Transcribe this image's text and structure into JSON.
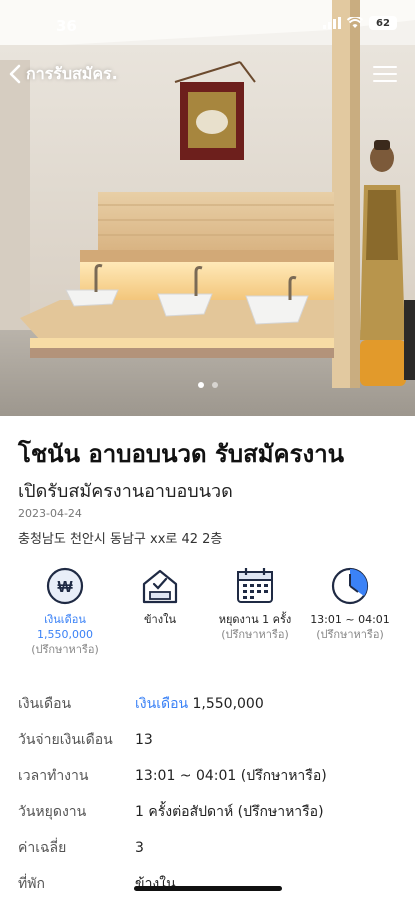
{
  "status_bar": {
    "time": "36",
    "battery": "62"
  },
  "nav": {
    "back_label": "การรับสมัคร."
  },
  "carousel": {
    "count": 2,
    "active": 0
  },
  "job": {
    "title": "โชนัน อาบอบนวด รับสมัครงาน",
    "subtitle": "เปิดรับสมัครงานอาบอบนวด",
    "date": "2023-04-24",
    "address": "충청남도 천안시 동남구 xx로 42 2층"
  },
  "features": [
    {
      "icon": "won-coin-icon",
      "label": "เงินเดือน\n1,550,000",
      "note": "(ปรึกษาหารือ)"
    },
    {
      "icon": "house-check-icon",
      "label": "ข้างใน",
      "note": ""
    },
    {
      "icon": "calendar-icon",
      "label": "หยุดงาน 1 ครั้ง",
      "note": "(ปรึกษาหารือ)"
    },
    {
      "icon": "clock-icon",
      "label": "13:01 ~ 04:01",
      "note": "(ปรึกษาหารือ)"
    }
  ],
  "details": [
    {
      "key": "เงินเดือน",
      "highlight": "เงินเดือน",
      "value": "1,550,000"
    },
    {
      "key": "วันจ่ายเงินเดือน",
      "highlight": "",
      "value": "13"
    },
    {
      "key": "เวลาทำงาน",
      "highlight": "",
      "value": "13:01 ~ 04:01 (ปรึกษาหารือ)"
    },
    {
      "key": "วันหยุดงาน",
      "highlight": "",
      "value": "1 ครั้งต่อสัปดาห์ (ปรึกษาหารือ)"
    },
    {
      "key": "ค่าเฉลี่ย",
      "highlight": "",
      "value": "3"
    },
    {
      "key": "ที่พัก",
      "highlight": "",
      "value": "ข้างใน"
    }
  ],
  "colors": {
    "accent": "#3b82f6"
  }
}
